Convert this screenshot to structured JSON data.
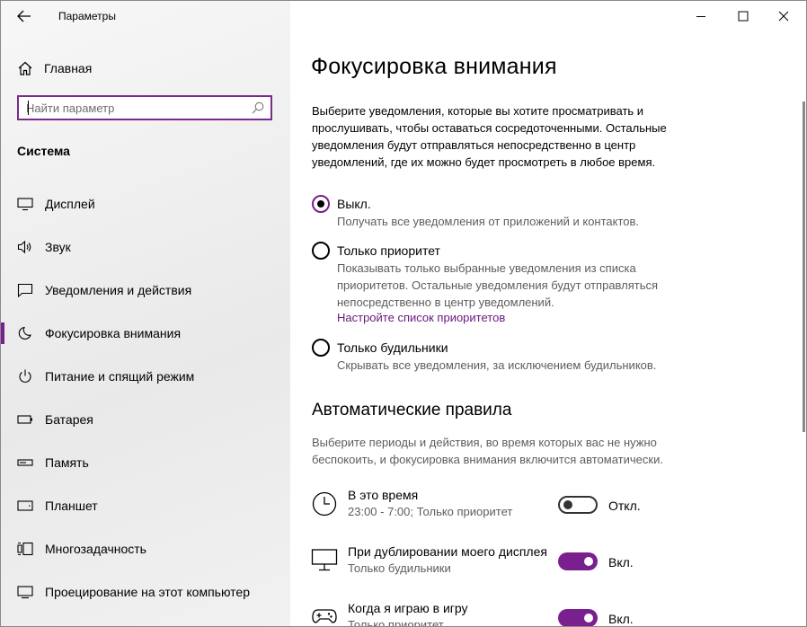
{
  "window": {
    "title": "Параметры"
  },
  "sidebar": {
    "home_label": "Главная",
    "search_placeholder": "Найти параметр",
    "section_title": "Система",
    "items": [
      {
        "label": "Дисплей",
        "icon": "monitor-icon"
      },
      {
        "label": "Звук",
        "icon": "speaker-icon"
      },
      {
        "label": "Уведомления и действия",
        "icon": "notification-icon"
      },
      {
        "label": "Фокусировка внимания",
        "icon": "moon-icon",
        "active": true
      },
      {
        "label": "Питание и спящий режим",
        "icon": "power-icon"
      },
      {
        "label": "Батарея",
        "icon": "battery-icon"
      },
      {
        "label": "Память",
        "icon": "storage-icon"
      },
      {
        "label": "Планшет",
        "icon": "tablet-icon"
      },
      {
        "label": "Многозадачность",
        "icon": "multitasking-icon"
      },
      {
        "label": "Проецирование на этот компьютер",
        "icon": "projecting-icon"
      }
    ]
  },
  "main": {
    "title": "Фокусировка внимания",
    "description": "Выберите уведомления, которые вы хотите просматривать и прослушивать, чтобы оставаться сосредоточенными. Остальные уведомления будут отправляться непосредственно в центр уведомлений, где их можно будет просмотреть в любое время.",
    "options": [
      {
        "title": "Выкл.",
        "desc": "Получать все уведомления от приложений и контактов.",
        "checked": true
      },
      {
        "title": "Только приоритет",
        "desc": "Показывать только выбранные уведомления из списка приоритетов. Остальные уведомления будут отправляться непосредственно в центр уведомлений.",
        "link": "Настройте список приоритетов",
        "checked": false
      },
      {
        "title": "Только будильники",
        "desc": "Скрывать все уведомления, за исключением будильников.",
        "checked": false
      }
    ],
    "auto_rules": {
      "title": "Автоматические правила",
      "description": "Выберите периоды и действия, во время которых вас не нужно беспокоить, и фокусировка внимания включится автоматически.",
      "rules": [
        {
          "title": "В это время",
          "sub": "23:00 - 7:00; Только приоритет",
          "state": "Откл.",
          "on": false,
          "icon": "clock-icon"
        },
        {
          "title": "При дублировании моего дисплея",
          "sub": "Только будильники",
          "state": "Вкл.",
          "on": true,
          "icon": "monitor-icon"
        },
        {
          "title": "Когда я играю в игру",
          "sub": "Только приоритет",
          "state": "Вкл.",
          "on": true,
          "icon": "gamepad-icon"
        }
      ]
    }
  },
  "colors": {
    "accent": "#7a1f8e",
    "secondary_text": "#5d5d5d"
  }
}
